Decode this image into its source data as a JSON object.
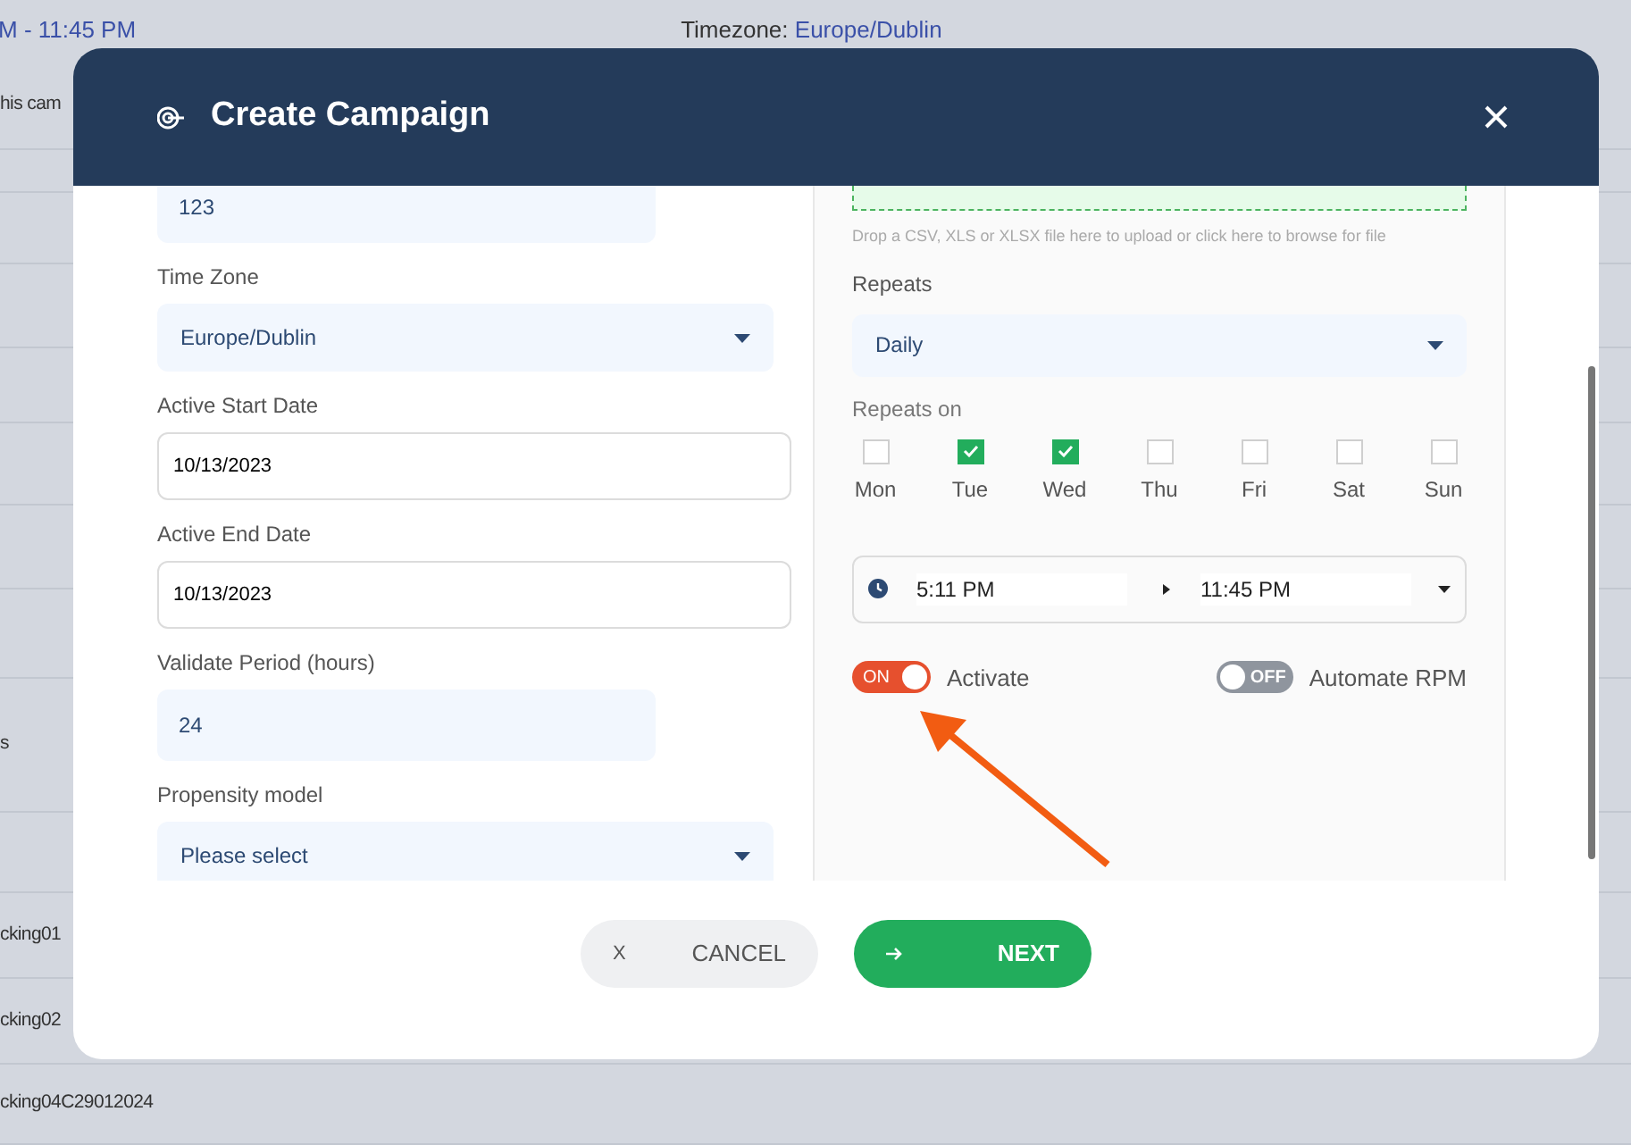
{
  "background_page": {
    "header": {
      "time_range": "M - 11:45 PM",
      "timezone_label": "Timezone:",
      "timezone_value": "Europe/Dublin"
    },
    "rows": [
      {
        "text": "his cam"
      },
      {
        "text": "s"
      },
      {
        "text": "cking01"
      },
      {
        "text": "cking02"
      },
      {
        "text": "cking04C29012024"
      }
    ]
  },
  "dialog": {
    "title": "Create Campaign",
    "left_fields": [
      {
        "kind": "text",
        "value": "123"
      },
      {
        "kind": "select",
        "label": "Time Zone",
        "value": "Europe/Dublin"
      },
      {
        "kind": "date",
        "label": "Active Start Date",
        "value": "10/13/2023"
      },
      {
        "kind": "date",
        "label": "Active End Date",
        "value": "10/13/2023"
      },
      {
        "kind": "text",
        "label": "Validate Period (hours)",
        "value": "24"
      },
      {
        "kind": "select",
        "label": "Propensity model",
        "placeholder": "Please select"
      }
    ],
    "upload_hint": "Drop a CSV, XLS or XLSX file here to upload or click here to browse for file",
    "repeats": {
      "label": "Repeats",
      "value": "Daily"
    },
    "repeats_on": {
      "label": "Repeats on",
      "days": [
        {
          "label": "Mon",
          "checked": false
        },
        {
          "label": "Tue",
          "checked": true
        },
        {
          "label": "Wed",
          "checked": true
        },
        {
          "label": "Thu",
          "checked": false
        },
        {
          "label": "Fri",
          "checked": false
        },
        {
          "label": "Sat",
          "checked": false
        },
        {
          "label": "Sun",
          "checked": false
        }
      ]
    },
    "time_range": {
      "start": "5:11 PM",
      "end": "11:45 PM"
    },
    "toggles": [
      {
        "label": "Activate",
        "on": true,
        "switch_text": "ON"
      },
      {
        "label": "Automate RPM",
        "on": false,
        "switch_text": "OFF"
      }
    ],
    "buttons": [
      {
        "kind": "cancel",
        "icon_text": "X",
        "label": "CANCEL"
      },
      {
        "kind": "next",
        "label": "NEXT"
      }
    ]
  }
}
